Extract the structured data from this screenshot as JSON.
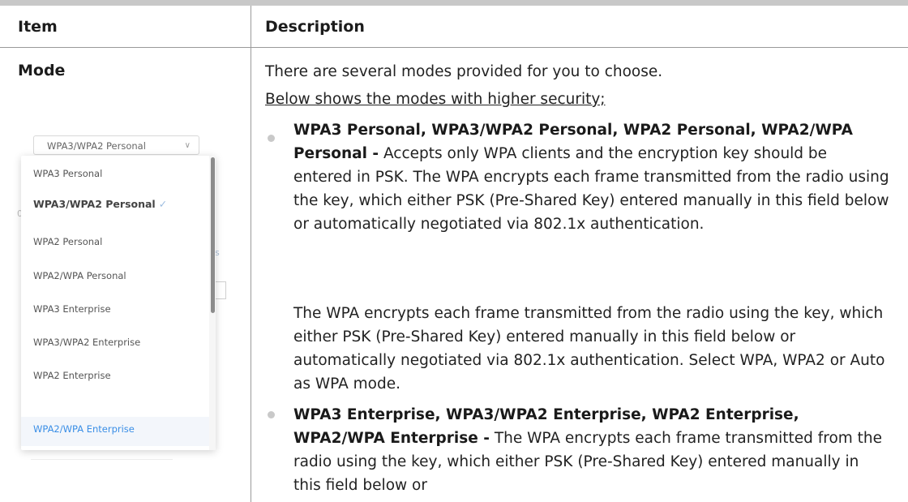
{
  "table": {
    "header_item": "Item",
    "header_description": "Description"
  },
  "row": {
    "item": "Mode",
    "intro": "There are several modes provided for you to choose.",
    "subheading": "Below shows the modes with higher security;",
    "bullet1_bold": "WPA3 Personal, WPA3/WPA2 Personal, WPA2 Personal, WPA2/WPA Personal -",
    "bullet1_text": " Accepts only WPA clients and the encryption key should be entered in PSK. The WPA encrypts each frame transmitted from the radio using the key, which either PSK (Pre-Shared Key) entered manually in this field below or automatically negotiated via 802.1x authentication.",
    "paragraph2": "The WPA encrypts each frame transmitted from the radio using the key, which either PSK (Pre-Shared Key) entered manually in this field below or automatically negotiated via 802.1x authentication. Select WPA, WPA2 or Auto as WPA mode.",
    "bullet2_bold": "WPA3 Enterprise, WPA3/WPA2 Enterprise, WPA2 Enterprise, WPA2/WPA Enterprise -",
    "bullet2_text": " The WPA encrypts each frame transmitted from the radio using the key, which either PSK (Pre-Shared Key) entered manually in this field below or"
  },
  "dropdown": {
    "selected": "WPA3/WPA2 Personal",
    "options": [
      "WPA3 Personal",
      "WPA3/WPA2 Personal",
      "WPA2 Personal",
      "WPA2/WPA Personal",
      "WPA3 Enterprise",
      "WPA3/WPA2 Enterprise",
      "WPA2 Enterprise",
      "WPA2/WPA Enterprise"
    ],
    "checkmark": "✓",
    "highlight_color": "#3a8ee6"
  },
  "fragments": {
    "left": "0:",
    "right": "s"
  }
}
